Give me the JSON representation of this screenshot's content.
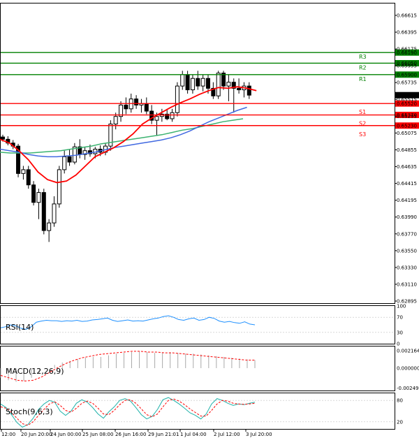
{
  "chart_data": {
    "type": "candlestick",
    "price_axis": {
      "ylim": [
        0.62895,
        0.66835
      ],
      "ticks": [
        "0.66615",
        "0.66395",
        "0.66175",
        "0.65955",
        "0.65735",
        "0.65515",
        "0.65295",
        "0.65075",
        "0.64855",
        "0.64635",
        "0.64415",
        "0.64195",
        "0.63990",
        "0.63770",
        "0.63550",
        "0.63330",
        "0.63110",
        "0.62895"
      ],
      "current_price": "0.65631"
    },
    "levels": [
      {
        "label": "R3",
        "value": 0.6619,
        "tag": "0.66190",
        "color": "#008000"
      },
      {
        "label": "R2",
        "value": 0.6605,
        "tag": "0.66050",
        "color": "#008000"
      },
      {
        "label": "R1",
        "value": 0.659,
        "tag": "0.65900",
        "color": "#008000"
      },
      {
        "label": "S1",
        "value": 0.6552,
        "tag": "0.65520",
        "color": "#ff0000"
      },
      {
        "label": "S2",
        "value": 0.6537,
        "tag": "0.65370",
        "color": "#ff0000"
      },
      {
        "label": "S3",
        "value": 0.6523,
        "tag": "0.65230",
        "color": "#ff0000"
      }
    ],
    "time_axis": [
      "12:00",
      "20 Jun 20:00",
      "24 Jun 00:00",
      "25 Jun 08:00",
      "26 Jun 16:00",
      "29 Jun 21:01",
      "1 Jul 04:00",
      "2 Jul 12:00",
      "3 Jul 20:00"
    ],
    "candles": [
      [
        0.6508,
        0.6511,
        0.6502,
        0.6505
      ],
      [
        0.6505,
        0.6509,
        0.6497,
        0.65
      ],
      [
        0.65,
        0.6504,
        0.6492,
        0.6496
      ],
      [
        0.6496,
        0.6499,
        0.6455,
        0.646
      ],
      [
        0.646,
        0.647,
        0.6452,
        0.6465
      ],
      [
        0.6465,
        0.647,
        0.644,
        0.6445
      ],
      [
        0.6445,
        0.645,
        0.6418,
        0.6422
      ],
      [
        0.6422,
        0.644,
        0.64,
        0.6435
      ],
      [
        0.6435,
        0.644,
        0.638,
        0.6385
      ],
      [
        0.6385,
        0.64,
        0.637,
        0.6395
      ],
      [
        0.6395,
        0.643,
        0.639,
        0.642
      ],
      [
        0.642,
        0.647,
        0.6415,
        0.6465
      ],
      [
        0.6465,
        0.649,
        0.646,
        0.6482
      ],
      [
        0.6482,
        0.6492,
        0.647,
        0.6475
      ],
      [
        0.6475,
        0.65,
        0.6472,
        0.6495
      ],
      [
        0.6495,
        0.6505,
        0.648,
        0.6485
      ],
      [
        0.6485,
        0.6495,
        0.6478,
        0.649
      ],
      [
        0.649,
        0.6498,
        0.6482,
        0.6486
      ],
      [
        0.6486,
        0.6495,
        0.648,
        0.6492
      ],
      [
        0.6492,
        0.6497,
        0.6483,
        0.6488
      ],
      [
        0.6488,
        0.65,
        0.6484,
        0.6496
      ],
      [
        0.6496,
        0.653,
        0.649,
        0.6525
      ],
      [
        0.6525,
        0.654,
        0.6518,
        0.6535
      ],
      [
        0.6535,
        0.6555,
        0.6528,
        0.655
      ],
      [
        0.655,
        0.656,
        0.6538,
        0.6545
      ],
      [
        0.6545,
        0.6565,
        0.654,
        0.6558
      ],
      [
        0.6558,
        0.6563,
        0.6545,
        0.655
      ],
      [
        0.655,
        0.6558,
        0.654,
        0.6552
      ],
      [
        0.6552,
        0.656,
        0.6538,
        0.6542
      ],
      [
        0.6542,
        0.655,
        0.6525,
        0.653
      ],
      [
        0.653,
        0.654,
        0.651,
        0.6535
      ],
      [
        0.6535,
        0.6545,
        0.6528,
        0.6538
      ],
      [
        0.6538,
        0.6545,
        0.653,
        0.6532
      ],
      [
        0.6532,
        0.6545,
        0.6528,
        0.654
      ],
      [
        0.654,
        0.658,
        0.6535,
        0.6575
      ],
      [
        0.6575,
        0.6595,
        0.657,
        0.659
      ],
      [
        0.659,
        0.6595,
        0.6565,
        0.657
      ],
      [
        0.657,
        0.659,
        0.6565,
        0.6585
      ],
      [
        0.6585,
        0.6595,
        0.657,
        0.6575
      ],
      [
        0.6575,
        0.659,
        0.6568,
        0.6585
      ],
      [
        0.6585,
        0.659,
        0.6565,
        0.6572
      ],
      [
        0.6572,
        0.658,
        0.6558,
        0.6562
      ],
      [
        0.6562,
        0.6595,
        0.6558,
        0.6592
      ],
      [
        0.6592,
        0.6595,
        0.657,
        0.6575
      ],
      [
        0.6575,
        0.659,
        0.6555,
        0.658
      ],
      [
        0.658,
        0.6585,
        0.654,
        0.6572
      ],
      [
        0.6572,
        0.6585,
        0.6565,
        0.657
      ],
      [
        0.657,
        0.658,
        0.656,
        0.6575
      ],
      [
        0.6575,
        0.658,
        0.6558,
        0.6563
      ]
    ],
    "ma_fast": [
      0.6505,
      0.65,
      0.649,
      0.6478,
      0.6462,
      0.6452,
      0.6448,
      0.645,
      0.6458,
      0.647,
      0.6482,
      0.6488,
      0.6494,
      0.6502,
      0.6512,
      0.6525,
      0.6533,
      0.654,
      0.6547,
      0.6553,
      0.6558,
      0.6564,
      0.6569,
      0.6573,
      0.6572,
      0.6574,
      0.6572,
      0.6569
    ],
    "ma_mid": [
      0.6492,
      0.649,
      0.6488,
      0.6485,
      0.6483,
      0.6482,
      0.6482,
      0.6483,
      0.6484,
      0.6486,
      0.6488,
      0.6491,
      0.6494,
      0.6496,
      0.6498,
      0.65,
      0.6502,
      0.6504,
      0.6507,
      0.6511,
      0.6516,
      0.6522,
      0.6528,
      0.6533,
      0.6538,
      0.6543,
      0.6547
    ],
    "ma_slow": [
      0.6488,
      0.6487,
      0.6487,
      0.6487,
      0.6488,
      0.6489,
      0.649,
      0.6492,
      0.6494,
      0.6496,
      0.6499,
      0.6501,
      0.6503,
      0.6505,
      0.6507,
      0.6509,
      0.6511,
      0.6514,
      0.6517,
      0.6519,
      0.6522,
      0.6525,
      0.6528,
      0.653,
      0.6532
    ],
    "rsi": {
      "label": "RSI(14)",
      "ticks": [
        "100",
        "70",
        "30",
        "0"
      ],
      "values": [
        42,
        45,
        50,
        47,
        41,
        38,
        45,
        57,
        60,
        62,
        61,
        61,
        59,
        61,
        60,
        62,
        59,
        60,
        63,
        64,
        66,
        68,
        62,
        59,
        61,
        63,
        60,
        61,
        60,
        63,
        66,
        68,
        72,
        74,
        70,
        64,
        62,
        66,
        68,
        62,
        64,
        70,
        67,
        60,
        57,
        59,
        56,
        54,
        58,
        52,
        50
      ]
    },
    "macd": {
      "label": "MACD(12,26,9)",
      "ticks": [
        "0.002164",
        "0.000000",
        "-0.002497"
      ],
      "histogram": [
        -0.0012,
        -0.0015,
        -0.0017,
        -0.0016,
        -0.0012,
        -0.0006,
        0.0,
        0.0004,
        0.0007,
        0.0009,
        0.0011,
        0.0013,
        0.0014,
        0.0014,
        0.0016,
        0.0018,
        0.0019,
        0.002,
        0.0021,
        0.002,
        0.0019,
        0.0019,
        0.002,
        0.0019,
        0.0018,
        0.0018,
        0.0017,
        0.0016,
        0.0015,
        0.0014,
        0.0013,
        0.0012,
        0.0011,
        0.001
      ],
      "signal": [
        -0.0009,
        -0.0012,
        -0.0015,
        -0.0016,
        -0.0015,
        -0.0011,
        -0.0005,
        0.0001,
        0.0006,
        0.001,
        0.0013,
        0.0015,
        0.0017,
        0.0018,
        0.0019,
        0.002,
        0.0021,
        0.0021,
        0.002,
        0.002,
        0.0019,
        0.0019,
        0.0018,
        0.0017,
        0.0016,
        0.0015,
        0.0014,
        0.0013,
        0.0012,
        0.0011,
        0.001,
        0.001
      ]
    },
    "stoch": {
      "label": "Stoch(9,6,3)",
      "ticks": [
        "80",
        "20"
      ],
      "main": [
        70,
        60,
        40,
        18,
        5,
        12,
        30,
        55,
        70,
        80,
        75,
        50,
        38,
        50,
        72,
        82,
        75,
        60,
        42,
        30,
        48,
        62,
        80,
        85,
        78,
        60,
        40,
        28,
        35,
        55,
        82,
        88,
        80,
        70,
        58,
        45,
        38,
        28,
        42,
        70,
        85,
        80,
        72,
        66,
        70,
        68,
        72,
        75
      ],
      "signal": [
        62,
        58,
        46,
        30,
        15,
        10,
        20,
        38,
        55,
        70,
        76,
        66,
        52,
        47,
        58,
        72,
        78,
        72,
        58,
        42,
        40,
        52,
        68,
        80,
        82,
        72,
        56,
        40,
        34,
        42,
        62,
        80,
        84,
        78,
        68,
        56,
        46,
        36,
        36,
        52,
        70,
        80,
        78,
        72,
        70,
        69,
        70,
        72
      ]
    }
  }
}
